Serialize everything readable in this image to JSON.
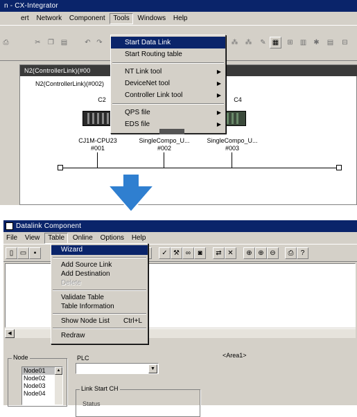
{
  "top": {
    "title": "n - CX-Integrator",
    "menubar": [
      "ert",
      "Network",
      "Component",
      "Tools",
      "Windows",
      "Help"
    ],
    "child_title": "N2(ControllerLink)(#00",
    "network_label": "N2(ControllerLink)(#002)",
    "tools_menu": {
      "items": [
        "Start Data Link",
        "Start Routing table",
        "NT Link tool",
        "DeviceNet tool",
        "Controller Link tool",
        "QPS file",
        "EDS file"
      ]
    },
    "nodes": [
      {
        "label": "C2",
        "name": "CJ1M-CPU23",
        "addr": "#001"
      },
      {
        "label": "",
        "name": "SingleCompo_U...",
        "addr": "#002"
      },
      {
        "label": "C4",
        "name": "SingleCompo_U...",
        "addr": "#003"
      }
    ]
  },
  "bottom": {
    "title": "Datalink Component",
    "menubar": [
      "File",
      "View",
      "Table",
      "Online",
      "Options",
      "Help"
    ],
    "table_menu": {
      "items": [
        "Wizard",
        "Add Source Link",
        "Add Destination",
        "Delete",
        "Validate Table",
        "Table Information",
        "Show Node List",
        "Redraw"
      ],
      "shortcut": "Ctrl+L"
    },
    "node_group": "Node",
    "nodes": [
      "Node01",
      "Node02",
      "Node03",
      "Node04"
    ],
    "plc_label": "PLC",
    "area_label": "<Area1>",
    "link_start": "Link Start CH",
    "status": "Status"
  },
  "colors": {
    "titlebar": "#0a246a",
    "highlight": "#0a246a",
    "arrow": "#2f7fd0",
    "face": "#d4d0c8"
  }
}
